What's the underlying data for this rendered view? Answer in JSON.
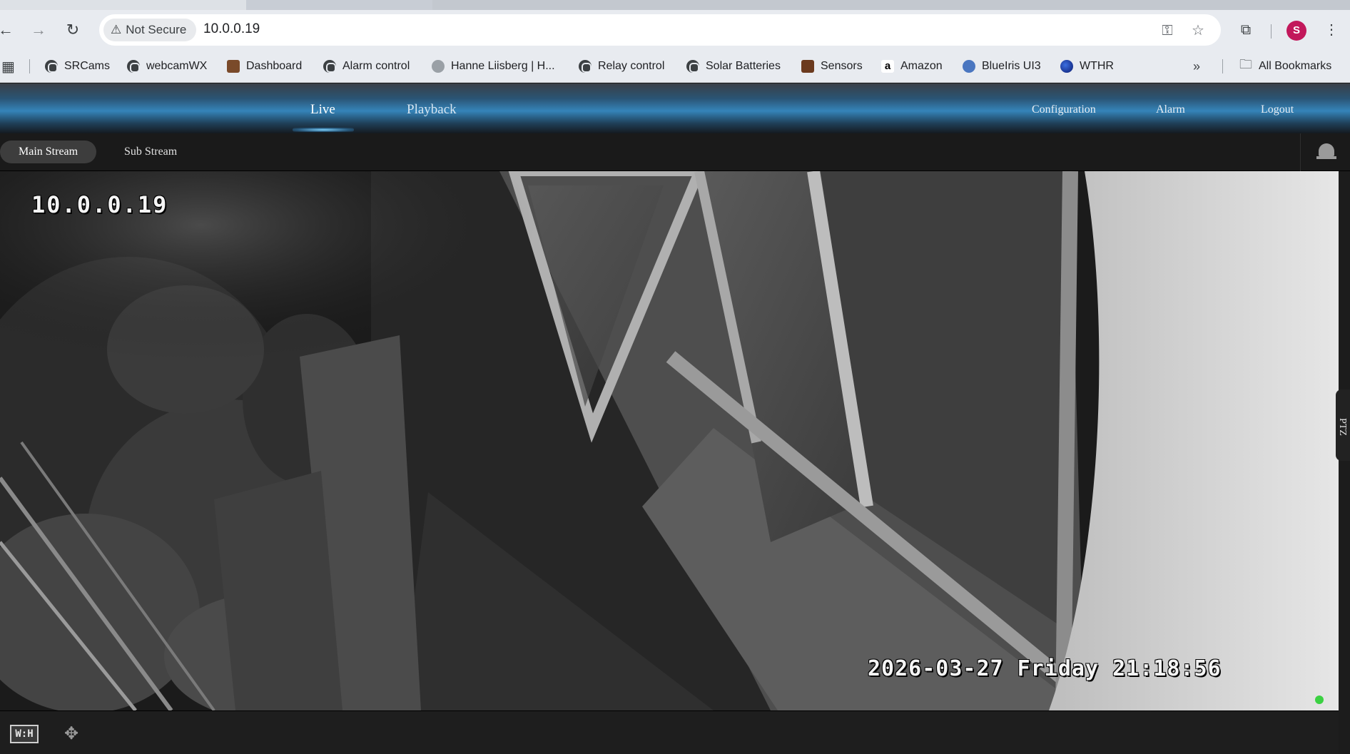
{
  "browser": {
    "security_label": "Not Secure",
    "url": "10.0.0.19",
    "avatar_initial": "S",
    "bookmarks": [
      {
        "label": "SRCams",
        "icon": "globe-icon"
      },
      {
        "label": "webcamWX",
        "icon": "globe-icon"
      },
      {
        "label": "Dashboard",
        "icon": "dashboard-favicon"
      },
      {
        "label": "Alarm control",
        "icon": "globe-icon"
      },
      {
        "label": "Hanne Liisberg | H...",
        "icon": "hanne-favicon"
      },
      {
        "label": "Relay control",
        "icon": "globe-icon"
      },
      {
        "label": "Solar Batteries",
        "icon": "globe-icon"
      },
      {
        "label": "Sensors",
        "icon": "sensors-favicon"
      },
      {
        "label": "Amazon",
        "icon": "amazon-favicon"
      },
      {
        "label": "BlueIris UI3",
        "icon": "blueiris-favicon"
      },
      {
        "label": "WTHR",
        "icon": "wthr-favicon"
      }
    ],
    "all_bookmarks_label": "All Bookmarks"
  },
  "app": {
    "nav": {
      "live": "Live",
      "playback": "Playback",
      "configuration": "Configuration",
      "alarm": "Alarm",
      "logout": "Logout"
    },
    "streams": {
      "main": "Main Stream",
      "sub": "Sub Stream"
    },
    "video": {
      "osd_ip": "10.0.0.19",
      "osd_timestamp": "2026-03-27 Friday 21:18:56"
    },
    "ptz_tab": "PTZ",
    "bottom": {
      "wh_label": "W:H"
    }
  },
  "colors": {
    "accent_nav": "#3584b9",
    "live_indicator": "#3bd142",
    "avatar": "#c2185b"
  }
}
